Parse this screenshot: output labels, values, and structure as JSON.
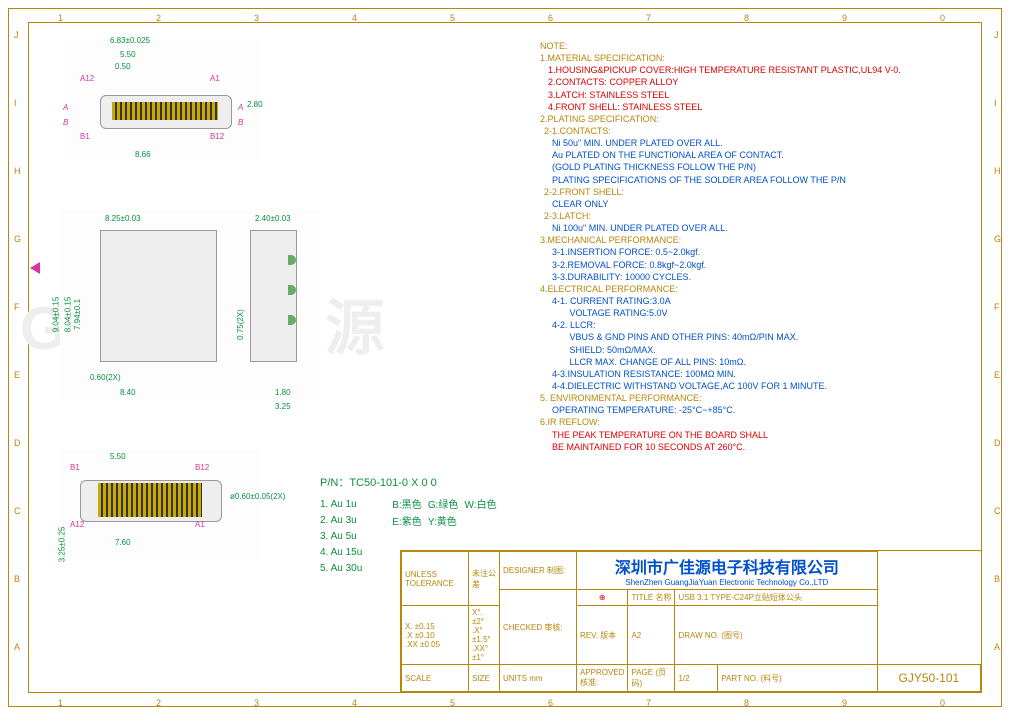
{
  "ruler_top": [
    "1",
    "2",
    "3",
    "4",
    "5",
    "6",
    "7",
    "8",
    "9",
    "0"
  ],
  "ruler_side": [
    "A",
    "B",
    "C",
    "D",
    "E",
    "F",
    "G",
    "H",
    "I",
    "J"
  ],
  "view_top": {
    "d1": "6.83±0.025",
    "d2": "5.50",
    "d3": "0.50",
    "d4": "2.80",
    "d5": "8.66",
    "p_a12": "A12",
    "p_a1": "A1",
    "p_b1": "B1",
    "p_b12": "B12",
    "a": "A",
    "b": "B"
  },
  "view_front": {
    "d1": "8.25±0.03",
    "d2": "2.40±0.03",
    "d3": "9.04±0.15",
    "d4": "8.04±0.15",
    "d5": "7.94±0.1",
    "d6": "0.75(2X)",
    "d7": "0.60(2X)",
    "d8": "8.40",
    "d9": "1.80",
    "d10": "3.25"
  },
  "view_bottom": {
    "d1": "5.50",
    "d2": "7.60",
    "d3": "3.25±0.25",
    "d4": "ø0.60±0.05(2X)",
    "p_a12": "A12",
    "p_a1": "A1",
    "p_b1": "B1",
    "p_b12": "B12"
  },
  "pn": {
    "main": "P/N：TC50-101-0 X 0 0",
    "opts": [
      "1. Au 1u",
      "2. Au 3u",
      "3. Au 5u",
      "4. Au 15u",
      "5. Au 30u"
    ],
    "colors": [
      "B:黑色",
      "G:绿色",
      "W:白色",
      "E:紫色",
      "Y:黄色"
    ]
  },
  "notes": {
    "hdr": "NOTE:",
    "s1h": "1.MATERIAL SPECIFICATION:",
    "s1": [
      "1.HOUSING&PICKUP COVER:HIGH TEMPERATURE RESISTANT PLASTIC,UL94 V-0.",
      "2.CONTACTS: COPPER ALLOY",
      "3.LATCH: STAINLESS STEEL",
      "4.FRONT SHELL: STAINLESS STEEL"
    ],
    "s2h": "2.PLATING SPECIFICATION:",
    "s21h": "2-1.CONTACTS:",
    "s21": [
      "Ni 50u\" MIN. UNDER PLATED OVER ALL.",
      "Au PLATED ON THE FUNCTIONAL AREA OF CONTACT.",
      "(GOLD PLATING THICKNESS FOLLOW THE P/N)",
      "PLATING SPECIFICATIONS OF THE SOLDER AREA FOLLOW THE P/N"
    ],
    "s22h": "2-2.FRONT SHELL:",
    "s22": "CLEAR ONLY",
    "s23h": "2-3.LATCH:",
    "s23": "Ni 100u\" MIN. UNDER PLATED OVER ALL.",
    "s3h": "3.MECHANICAL PERFORMANCE:",
    "s3": [
      "3-1.INSERTION FORCE: 0.5~2.0kgf.",
      "3-2.REMOVAL FORCE: 0.8kgf~2.0kgf.",
      "3-3.DURABILITY: 10000 CYCLES."
    ],
    "s4h": "4.ELECTRICAL PERFORMANCE:",
    "s4": [
      "4-1. CURRENT RATING:3.0A",
      "       VOLTAGE RATING:5.0V",
      "4-2. LLCR:",
      "       VBUS & GND PINS AND OTHER PINS: 40mΩ/PIN MAX.",
      "       SHIELD: 50mΩ/MAX.",
      "       LLCR MAX. CHANGE OF ALL PINS: 10mΩ.",
      "4-3.INSULATION RESISTANCE: 100MΩ MIN.",
      "4-4.DIELECTRIC WITHSTAND VOLTAGE,AC 100V FOR 1 MINUTE."
    ],
    "s5h": "5. ENVIRONMENTAL PERFORMANCE:",
    "s5": "OPERATING TEMPERATURE: -25°C~+85°C.",
    "s6h": "6.IR REFLOW:",
    "s6": [
      "THE PEAK TEMPERATURE ON THE BOARD SHALL",
      "BE MAINTAINED FOR 10 SECONDS AT 260°C."
    ]
  },
  "titleblock": {
    "unless": "UNLESS TOLERANCE",
    "unless_cn": "未注公差",
    "tol1a": "X. ±0.15",
    "tol1b": "X°. ±2°",
    "tol2a": ".X ±0.10",
    "tol2b": ".X° ±1.5°",
    "tol3a": ".XX ±0.05",
    "tol3b": ".XX° ±1°",
    "designer": "DESIGNER 制图:",
    "checked": "CHECKED 审核:",
    "approved": "APPROVED 核准:",
    "scale": "SCALE",
    "size": "SIZE",
    "units": "UNITS",
    "units_v": "mm",
    "company_cn": "深圳市广佳源电子科技有限公司",
    "company_en": "ShenZhen GuangJiaYuan Electronic Technology Co.,LTD",
    "proj": "⊕",
    "title_l": "TITLE 名称",
    "title_v": "USB 3.1 TYPE-C24P立贴短体公头",
    "rev_l": "REV. 版本",
    "rev_v": "A2",
    "draw_l": "DRAW NO. (图号)",
    "page_l": "PAGE (页码)",
    "page_v": "1/2",
    "part_l": "PART NO. (料号)",
    "part_v": "GJY50-101"
  },
  "watermark": "GJY-广佳源"
}
